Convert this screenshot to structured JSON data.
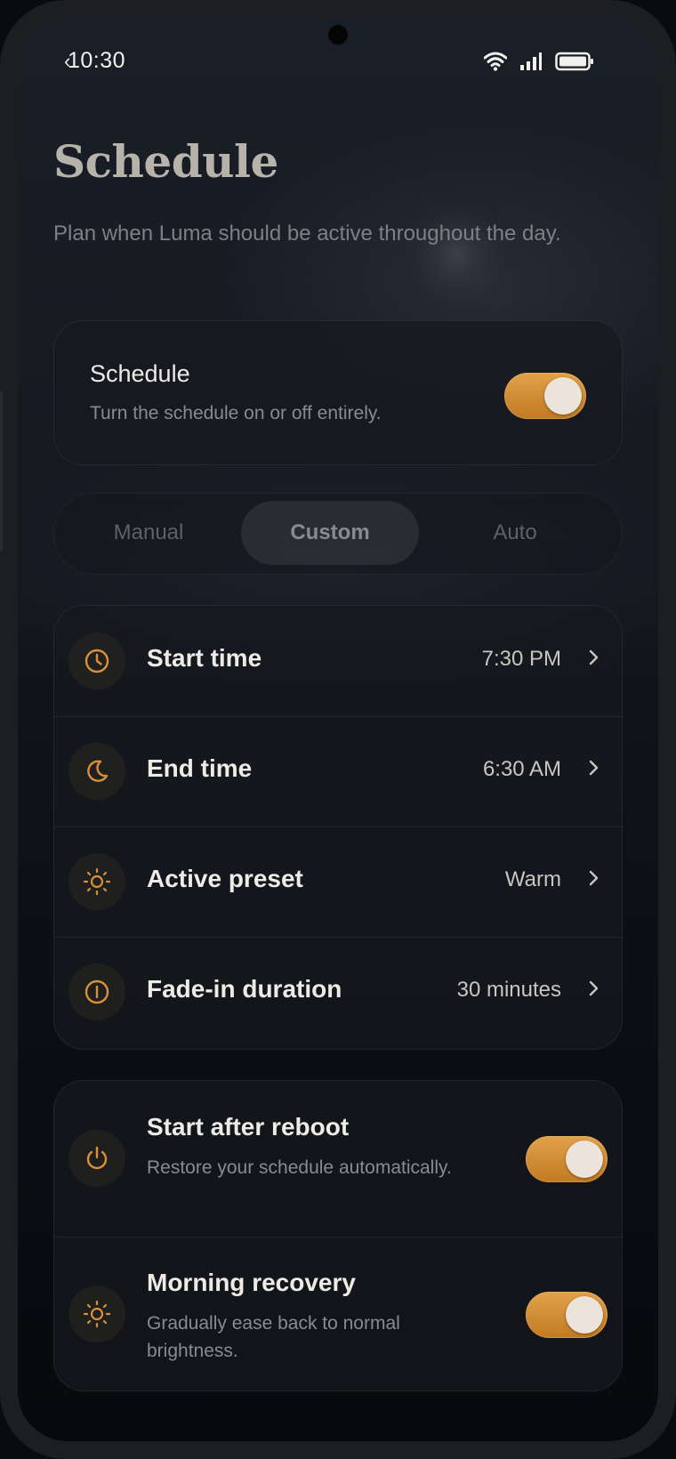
{
  "status_bar": {
    "time": "10:30",
    "back_glyph": "‹"
  },
  "header": {
    "title": "Schedule",
    "subtitle": "Plan when Luma should be active throughout the day."
  },
  "master": {
    "title": "Schedule",
    "description": "Turn the schedule on or off entirely.",
    "enabled": true
  },
  "mode_selector": {
    "options": [
      "Manual",
      "Custom",
      "Auto"
    ],
    "selected": "Custom"
  },
  "settings": [
    {
      "label": "Start time",
      "value": "7:30 PM",
      "icon": "clock-icon"
    },
    {
      "label": "End time",
      "value": "6:30 AM",
      "icon": "moon-icon"
    },
    {
      "label": "Active preset",
      "value": "Warm",
      "icon": "sun-icon"
    },
    {
      "label": "Fade-in duration",
      "value": "30 minutes",
      "icon": "fade-icon"
    }
  ],
  "toggles": [
    {
      "title": "Start after reboot",
      "description": "Restore your schedule automatically.",
      "icon": "power-icon",
      "enabled": true
    },
    {
      "title": "Morning recovery",
      "description": "Gradually ease back to normal brightness.",
      "icon": "sun-icon",
      "enabled": true
    }
  ],
  "colors": {
    "accent": "#d8913a",
    "background": "#10141a",
    "text": "#eeebe6",
    "muted": "#8a8b8f"
  }
}
